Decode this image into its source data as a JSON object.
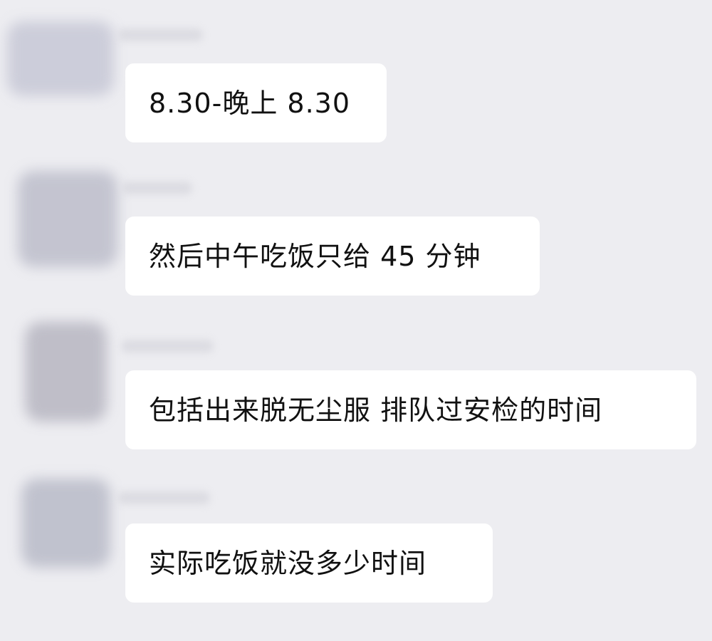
{
  "messages": [
    {
      "text": "8.30-晚上 8.30"
    },
    {
      "text": "然后中午吃饭只给 45 分钟"
    },
    {
      "text": "包括出来脱无尘服 排队过安检的时间"
    },
    {
      "text": "实际吃饭就没多少时间"
    }
  ],
  "colors": {
    "background": "#ededf1",
    "bubble": "#ffffff",
    "text": "#111111"
  }
}
